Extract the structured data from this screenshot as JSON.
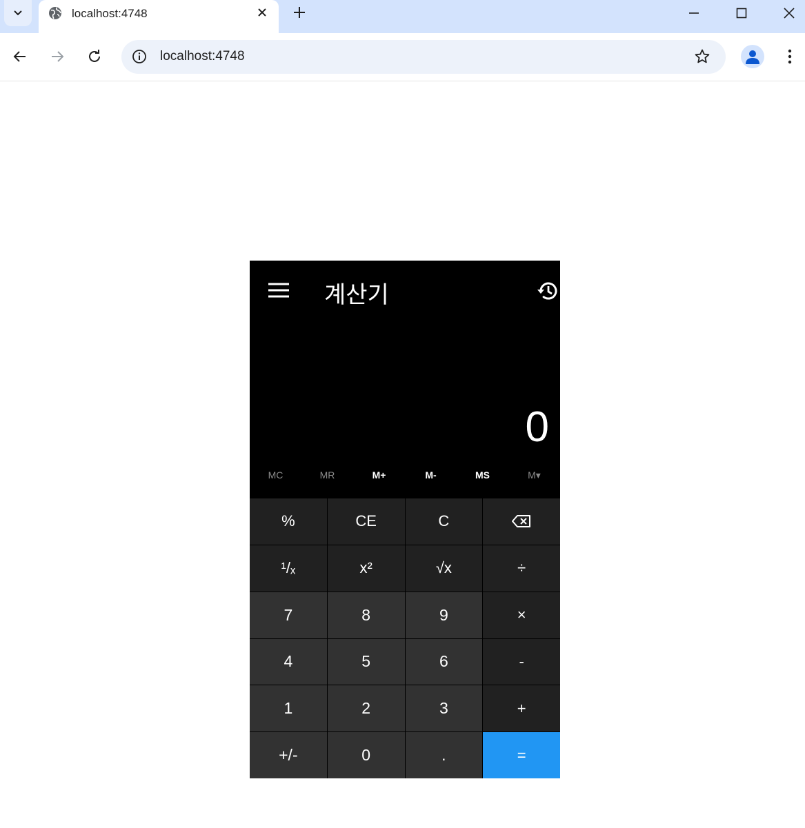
{
  "browser": {
    "tab_title": "localhost:4748",
    "url": "localhost:4748"
  },
  "calculator": {
    "title": "계산기",
    "display_value": "0",
    "memory_buttons": [
      {
        "label": "MC",
        "enabled": false
      },
      {
        "label": "MR",
        "enabled": false
      },
      {
        "label": "M+",
        "enabled": true
      },
      {
        "label": "M-",
        "enabled": true
      },
      {
        "label": "MS",
        "enabled": true
      },
      {
        "label": "M▾",
        "enabled": false
      }
    ],
    "keys": {
      "percent": "%",
      "ce": "CE",
      "c": "C",
      "backspace": "⌫",
      "reciprocal": "¹/ₓ",
      "square": "x²",
      "sqrt": "√x",
      "divide": "÷",
      "seven": "7",
      "eight": "8",
      "nine": "9",
      "multiply": "×",
      "four": "4",
      "five": "5",
      "six": "6",
      "minus": "-",
      "one": "1",
      "two": "2",
      "three": "3",
      "plus": "+",
      "negate": "+/-",
      "zero": "0",
      "decimal": ".",
      "equals": "="
    },
    "colors": {
      "equals_key": "#2196f3",
      "function_key": "#212121",
      "number_key": "#323232"
    }
  }
}
